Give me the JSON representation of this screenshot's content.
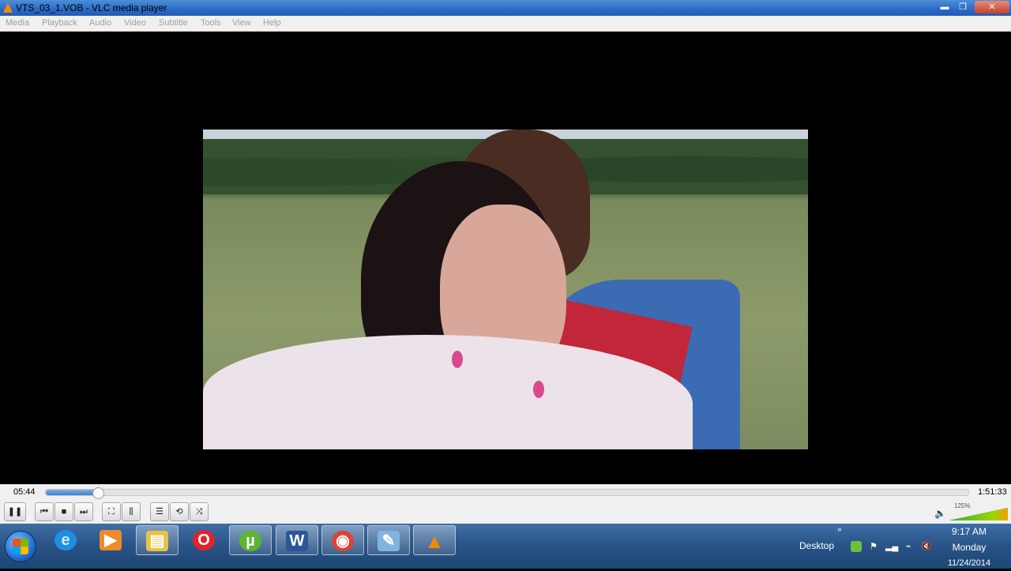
{
  "window": {
    "title": "VTS_03_1.VOB - VLC media player",
    "minimize_glyph": "▬",
    "maximize_glyph": "❐",
    "close_glyph": "✕"
  },
  "menu": [
    "Media",
    "Playback",
    "Audio",
    "Video",
    "Subtitle",
    "Tools",
    "View",
    "Help"
  ],
  "playback": {
    "elapsed": "05:44",
    "total": "1:51:33",
    "progress": 0.051
  },
  "controls": {
    "pause": "❚❚",
    "previous": "⏮",
    "stop": "■",
    "next": "⏭",
    "fullscreen": "⛶",
    "extended": "⫼",
    "playlist": "☰",
    "loop": "⟲",
    "shuffle": "⤨"
  },
  "volume": {
    "percent_label": "125%",
    "level": 1.25,
    "icon": "speaker-icon"
  },
  "taskbar": {
    "apps": [
      {
        "name": "internet-explorer",
        "glyph": "e",
        "color": "#1e8fe0"
      },
      {
        "name": "media-player",
        "glyph": "▶",
        "color": "#f08a2a"
      },
      {
        "name": "file-explorer",
        "glyph": "▤",
        "color": "#e9c24a"
      },
      {
        "name": "opera",
        "glyph": "O",
        "color": "#e0222a"
      },
      {
        "name": "utorrent",
        "glyph": "µ",
        "color": "#5bb531"
      },
      {
        "name": "word",
        "glyph": "W",
        "color": "#2b5797"
      },
      {
        "name": "chrome",
        "glyph": "◉",
        "color": "#db4437"
      },
      {
        "name": "paint",
        "glyph": "✎",
        "color": "#7fb4e0"
      },
      {
        "name": "vlc",
        "glyph": "▲",
        "color": "#f08a00"
      }
    ],
    "desktop_label": "Desktop",
    "chevron": "»",
    "time": "9:17 AM",
    "day": "Monday",
    "date": "11/24/2014"
  }
}
